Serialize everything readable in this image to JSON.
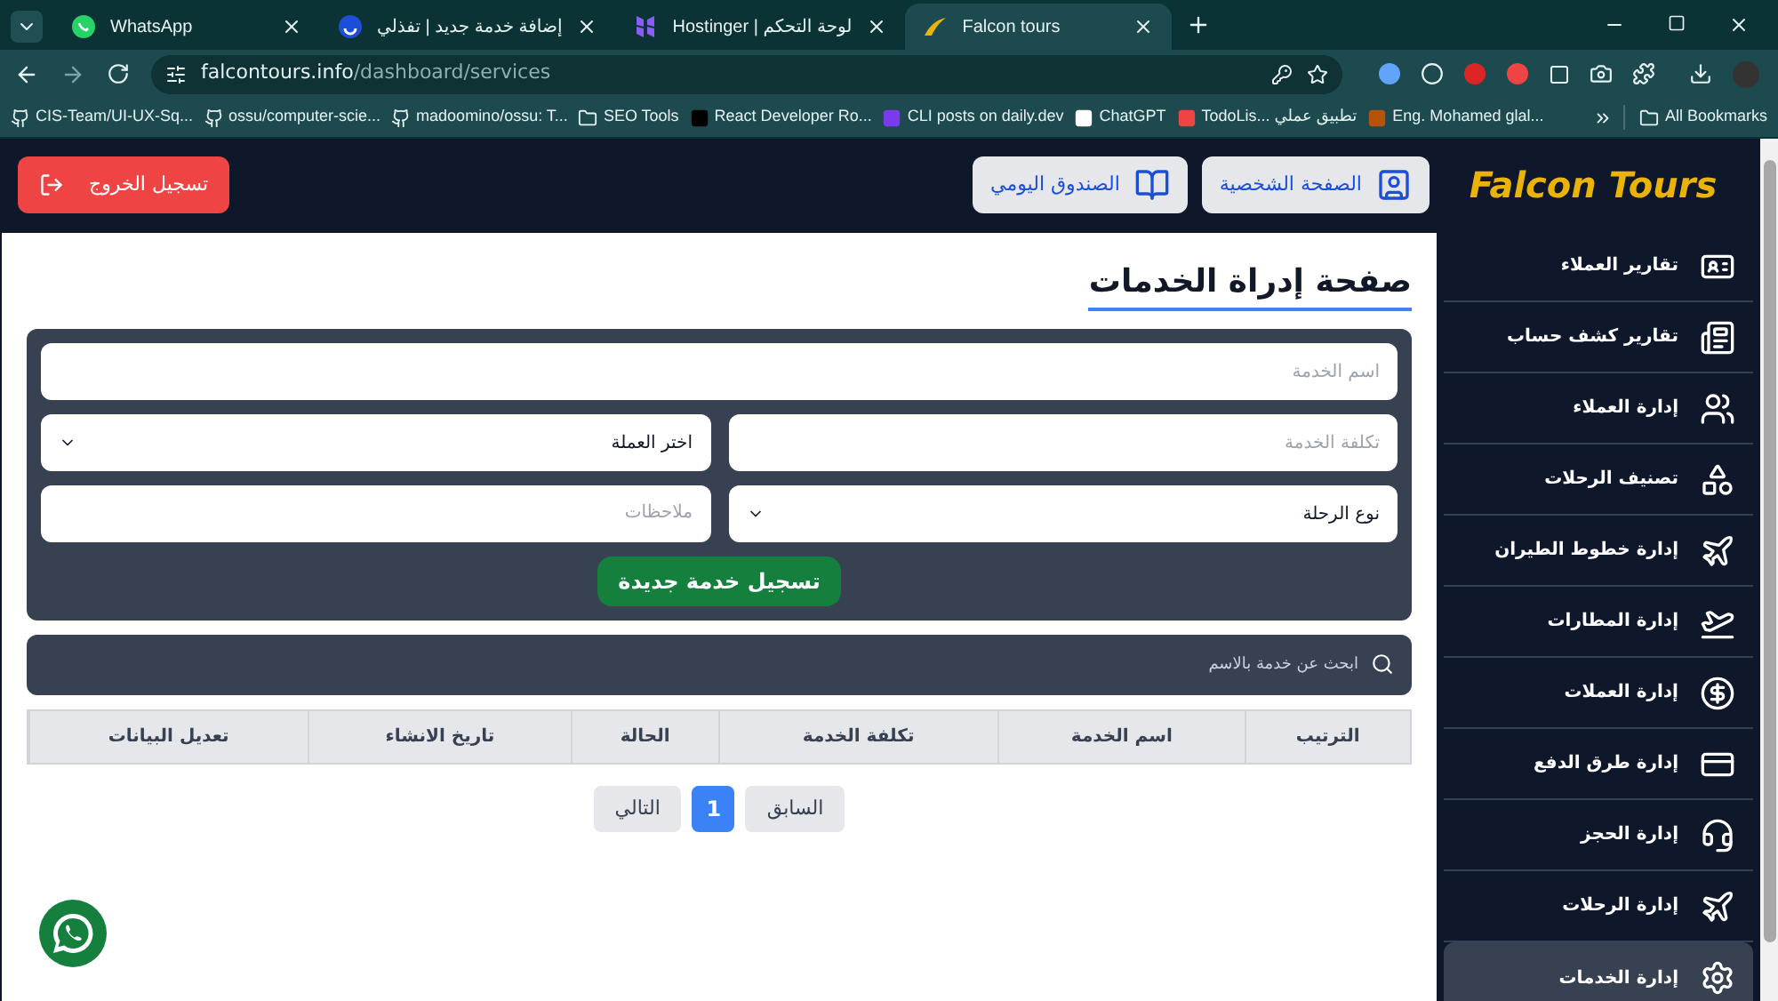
{
  "browser": {
    "tabs": [
      {
        "title": "Falcon tours",
        "selected": true
      },
      {
        "title": "Hostinger | لوحة التحكم",
        "selected": false
      },
      {
        "title": "إضافة خدمة جديد | تفذلي",
        "selected": false
      },
      {
        "title": "WhatsApp",
        "selected": false
      }
    ],
    "url": {
      "domain": "falcontours.info",
      "path": "/dashboard/services"
    },
    "bookmarks": [
      {
        "label": "Eng. Mohamed glal..."
      },
      {
        "label": "TodoLis... تطبيق عملي"
      },
      {
        "label": "ChatGPT"
      },
      {
        "label": "CLI posts on daily.dev"
      },
      {
        "label": "React Developer Ro..."
      },
      {
        "label": "SEO Tools"
      },
      {
        "label": "madoomino/ossu: T..."
      },
      {
        "label": "ossu/computer-scie..."
      },
      {
        "label": "CIS-Team/UI-UX-Sq..."
      }
    ],
    "all_bookmarks": "All Bookmarks"
  },
  "header": {
    "brand": "Falcon Tours",
    "buttons": [
      "الصفحة الشخصية",
      "الصندوق اليومي"
    ],
    "logout": "تسجيل الخروج"
  },
  "sidebar": {
    "items": [
      {
        "label": "تقارير العملاء",
        "selected": false
      },
      {
        "label": "تقارير كشف حساب",
        "selected": false
      },
      {
        "label": "إدارة العملاء",
        "selected": false
      },
      {
        "label": "تصنيف الرحلات",
        "selected": false
      },
      {
        "label": "إدارة خطوط الطيران",
        "selected": false
      },
      {
        "label": "إدارة المطارات",
        "selected": false
      },
      {
        "label": "إدارة العملات",
        "selected": false
      },
      {
        "label": "إدارة طرق الدفع",
        "selected": false
      },
      {
        "label": "إدارة الحجز",
        "selected": false
      },
      {
        "label": "إدارة الرحلات",
        "selected": false
      },
      {
        "label": "إدارة الخدمات",
        "selected": true
      }
    ]
  },
  "page_title": "صفحة إدراة الخدمات",
  "form": {
    "service_name": {
      "placeholder": "اسم الخدمة"
    },
    "service_cost": {
      "placeholder": "تكلفة الخدمة"
    },
    "currency": {
      "value": "اختر العملة"
    },
    "trip_type": {
      "value": "نوع الرحلة"
    },
    "notes": {
      "placeholder": "ملاحظات"
    },
    "submit": "تسجيل خدمة جديدة"
  },
  "search": {
    "placeholder": "ابحث عن خدمة بالاسم"
  },
  "table": {
    "columns": [
      "الترتيب",
      "اسم الخدمة",
      "تكلفة الخدمة",
      "الحالة",
      "تاريخ الانشاء",
      "تعديل البيانات"
    ]
  },
  "pagination": {
    "previous": "السابق",
    "pages": [
      {
        "label": "1",
        "selected": true
      }
    ],
    "next": "التالي"
  }
}
